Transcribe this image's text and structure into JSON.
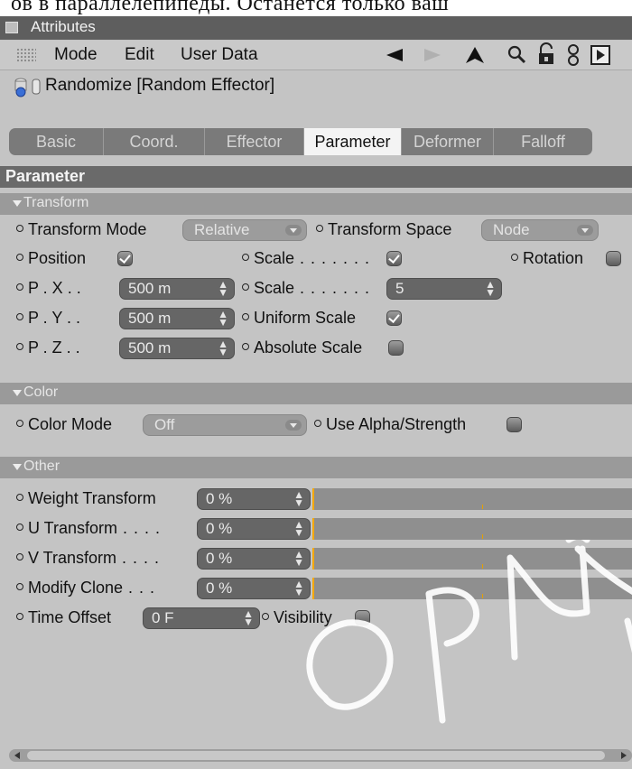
{
  "doc_text": "ов в параллелепипеды. Останется только ваш",
  "window": {
    "title": "Attributes"
  },
  "menubar": {
    "items": [
      "Mode",
      "Edit",
      "User Data"
    ],
    "tool_icons": [
      "back-arrow-icon",
      "forward-arrow-icon",
      "up-arrow-icon",
      "search-icon",
      "lock-icon",
      "link-icon",
      "new-panel-icon"
    ]
  },
  "object": {
    "name": "Randomize [Random Effector]"
  },
  "tabs": [
    {
      "label": "Basic",
      "active": false
    },
    {
      "label": "Coord.",
      "active": false
    },
    {
      "label": "Effector",
      "active": false
    },
    {
      "label": "Parameter",
      "active": true
    },
    {
      "label": "Deformer",
      "active": false
    },
    {
      "label": "Falloff",
      "active": false
    }
  ],
  "section_title": "Parameter",
  "transform": {
    "header": "Transform",
    "transform_mode_label": "Transform Mode",
    "transform_mode_value": "Relative",
    "transform_space_label": "Transform Space",
    "transform_space_value": "Node",
    "position_label": "Position",
    "position_checked": true,
    "scale_label": "Scale",
    "scale_checked": true,
    "rotation_label": "Rotation",
    "rotation_checked": false,
    "px_label": "P . X . .",
    "px_value": "500 m",
    "py_label": "P . Y . .",
    "py_value": "500 m",
    "pz_label": "P . Z . .",
    "pz_value": "500 m",
    "scale_value_label": "Scale",
    "scale_value": "5",
    "uniform_scale_label": "Uniform Scale",
    "uniform_scale_checked": true,
    "absolute_scale_label": "Absolute Scale",
    "absolute_scale_checked": false
  },
  "color": {
    "header": "Color",
    "color_mode_label": "Color Mode",
    "color_mode_value": "Off",
    "use_alpha_label": "Use Alpha/Strength",
    "use_alpha_checked": false
  },
  "other": {
    "header": "Other",
    "rows": [
      {
        "label": "Weight Transform",
        "value": "0 %",
        "fraction": 0
      },
      {
        "label": "U Transform",
        "value": "0 %",
        "fraction": 0
      },
      {
        "label": "V Transform",
        "value": "0 %",
        "fraction": 0
      },
      {
        "label": "Modify Clone",
        "value": "0 %",
        "fraction": 0
      }
    ],
    "time_offset_label": "Time Offset",
    "time_offset_value": "0 F",
    "visibility_label": "Visibility",
    "visibility_checked": false
  },
  "colors": {
    "titlebar": "#5e5e5e",
    "panel": "#c4c4c4",
    "active_tab": "#f4f4f4",
    "slider_marker": "#f5a800"
  }
}
